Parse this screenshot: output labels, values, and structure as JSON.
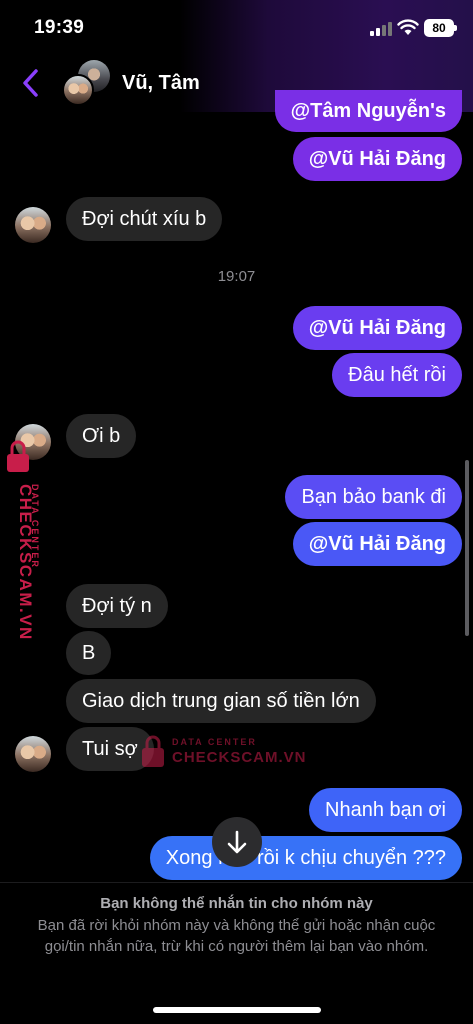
{
  "status_bar": {
    "time": "19:39",
    "battery": "80"
  },
  "header": {
    "title": "Vũ, Tâm"
  },
  "messages": {
    "m1": "@Tâm Nguyễn's",
    "m2": "@Vũ Hải Đăng",
    "m3": "Đợi chút xíu b",
    "timestamp": "19:07",
    "m4": "@Vũ Hải Đăng",
    "m5": "Đâu hết rồi",
    "m6": "Ơi b",
    "m7": "Bạn bảo bank đi",
    "m8": "@Vũ Hải Đăng",
    "m9": "Đợi tý n",
    "m10": "B",
    "m11": "Giao dịch trung gian số tiền lớn",
    "m12": "Tui sợ",
    "m13": "Nhanh bạn ơi",
    "m14": "Xong nhỏ rồi k chịu chuyển ???"
  },
  "watermark": {
    "vertical_top": "DATA CENTER",
    "vertical_main": "CHECKSCAM.VN",
    "small_top": "DATA CENTER",
    "small_main": "CHECKSCAM.VN",
    "color": "#c81e4a"
  },
  "footer": {
    "title": "Bạn không thể nhắn tin cho nhóm này",
    "description": "Bạn đã rời khỏi nhóm này và không thể gửi hoặc nhận cuộc gọi/tin nhắn nữa, trừ khi có người thêm lại bạn vào nhóm."
  },
  "icons": {
    "back": "chevron-left-icon",
    "scroll_down": "arrow-down-icon",
    "signal": "signal-icon",
    "wifi": "wifi-icon"
  },
  "colors": {
    "accent": "#8a3ffc",
    "incoming_bubble": "#262626",
    "outgoing_top": "#7a2fe6",
    "outgoing_bottom": "#3772f7"
  }
}
